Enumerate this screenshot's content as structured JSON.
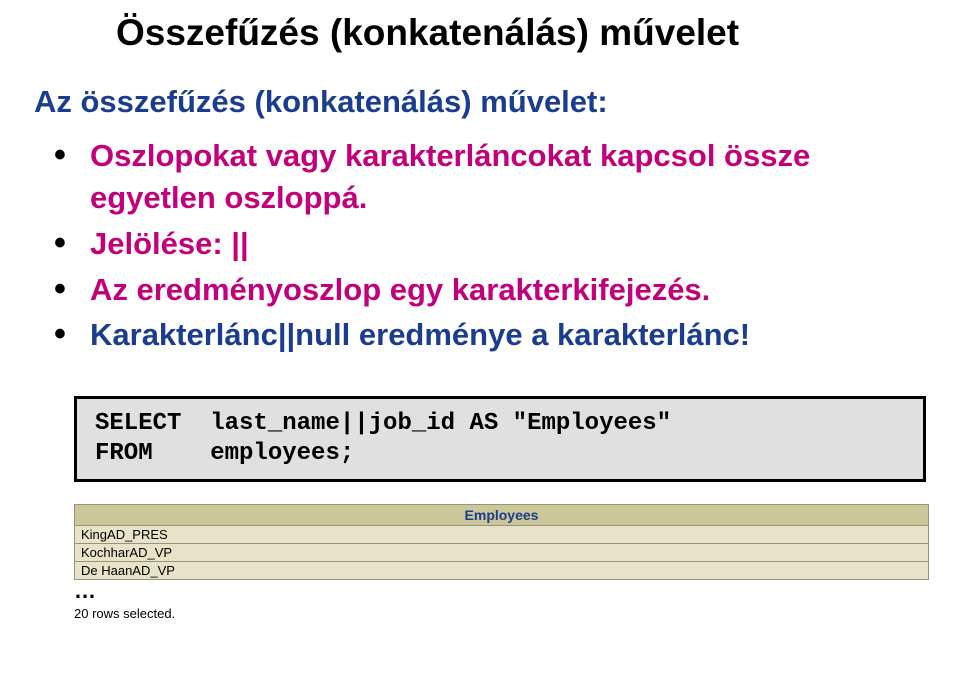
{
  "title": "Összefűzés (konkatenálás) művelet",
  "subtitle": "Az összefűzés (konkatenálás) művelet:",
  "bullets": {
    "b0": "Oszlopokat vagy karakterláncokat kapcsol össze egyetlen oszloppá.",
    "b1": "Jelölése: ||",
    "b2": "Az eredményoszlop egy karakterkifejezés.",
    "b3": "Karakterlánc||null eredménye a karakterlánc!"
  },
  "code": "SELECT  last_name||job_id AS \"Employees\"\nFROM    employees;",
  "table": {
    "header": "Employees",
    "rows": [
      "KingAD_PRES",
      "KochharAD_VP",
      "De HaanAD_VP"
    ]
  },
  "ellipsis": "…",
  "rows_selected": "20 rows selected."
}
